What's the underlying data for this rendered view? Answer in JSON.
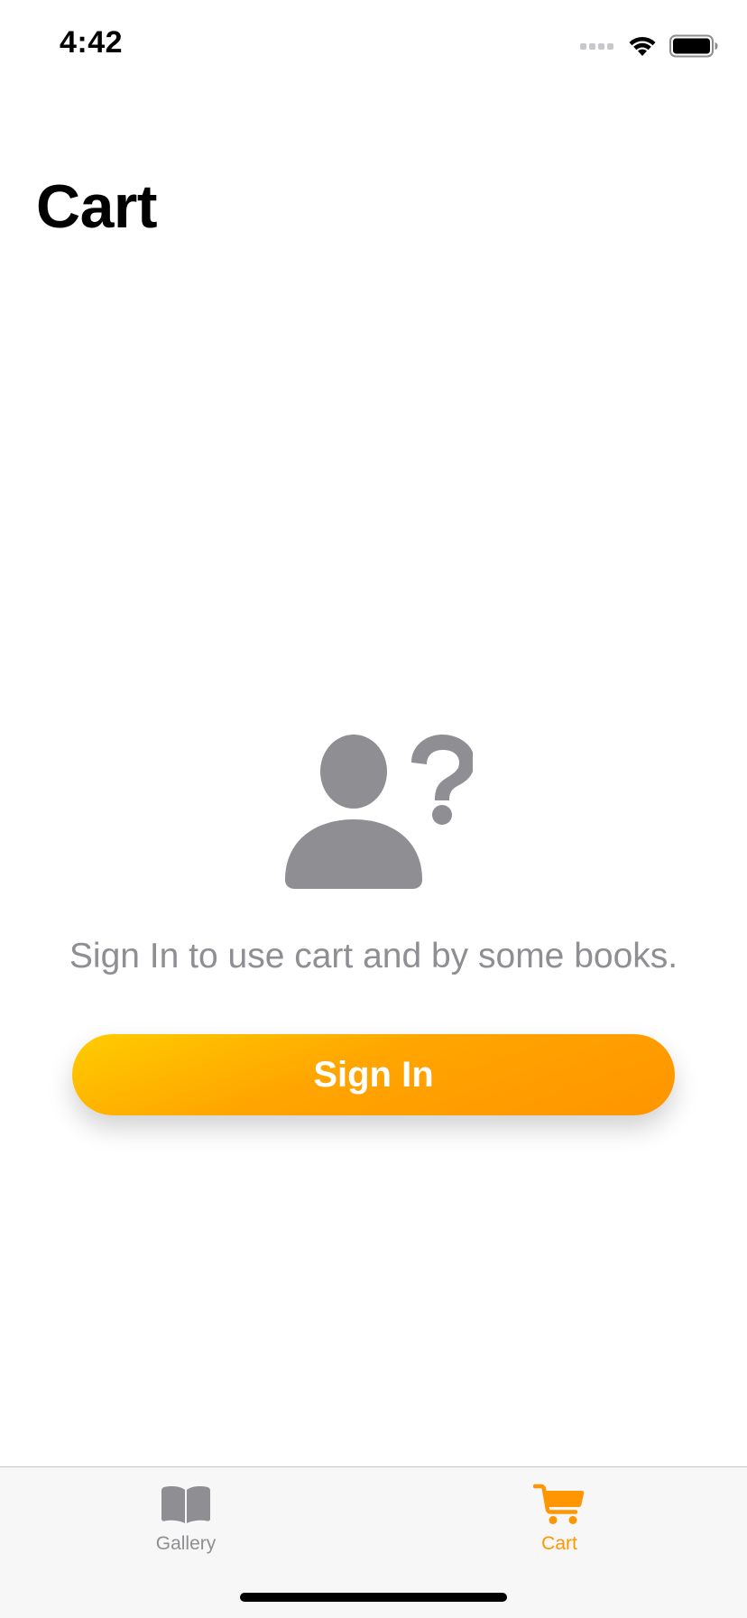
{
  "status_bar": {
    "time": "4:42"
  },
  "header": {
    "title": "Cart"
  },
  "empty_state": {
    "icon": "person-question-icon",
    "message": "Sign In to use cart and by some books.",
    "button_label": "Sign In"
  },
  "tab_bar": {
    "items": [
      {
        "label": "Gallery",
        "icon": "book-icon",
        "selected": false
      },
      {
        "label": "Cart",
        "icon": "cart-icon",
        "selected": true
      }
    ]
  },
  "colors": {
    "accent": "#ff9500",
    "gradient_start": "#ffcc00",
    "inactive": "#8e8e93"
  }
}
